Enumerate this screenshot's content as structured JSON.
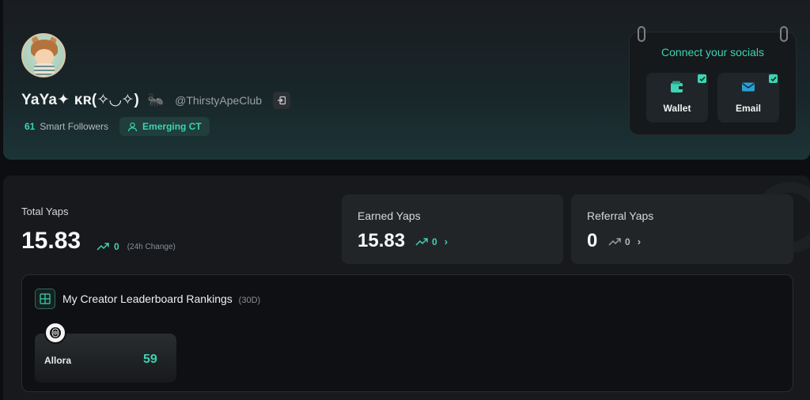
{
  "profile": {
    "display_name": "YaYa✦ ᴋʀ(✧◡✧)",
    "name_emoji_icon": "ant-icon",
    "handle": "@ThirstyApeClub",
    "smart_followers_count": "61",
    "smart_followers_label": "Smart Followers",
    "tier_badge": "Emerging CT"
  },
  "socials": {
    "title": "Connect your socials",
    "items": [
      {
        "label": "Wallet",
        "icon": "wallet-icon",
        "connected": true
      },
      {
        "label": "Email",
        "icon": "email-icon",
        "connected": true
      }
    ]
  },
  "stats": {
    "total": {
      "label": "Total Yaps",
      "value": "15.83",
      "change": "0",
      "change_note": "(24h Change)"
    },
    "earned": {
      "label": "Earned Yaps",
      "value": "15.83",
      "change": "0"
    },
    "referral": {
      "label": "Referral Yaps",
      "value": "0",
      "change": "0"
    }
  },
  "leaderboard": {
    "title": "My Creator Leaderboard Rankings",
    "range": "(30D)",
    "projects": [
      {
        "name": "Allora",
        "rank": "59"
      }
    ]
  },
  "colors": {
    "accent": "#3fd2b4",
    "background": "#0d0e11",
    "card": "#222528"
  }
}
